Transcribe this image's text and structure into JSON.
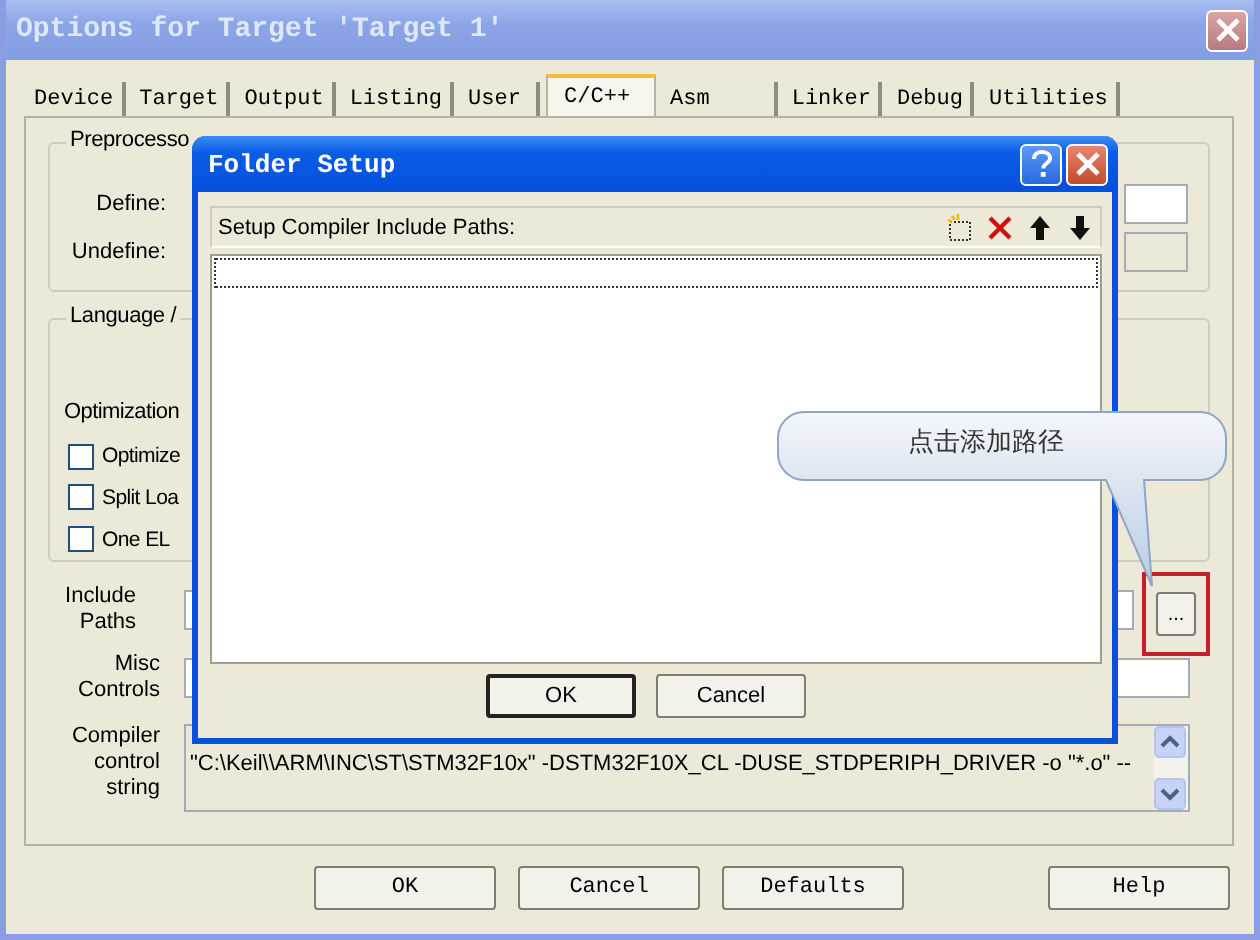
{
  "window": {
    "title": "Options for Target 'Target 1'"
  },
  "tabs": [
    {
      "label": "Device",
      "selected": false
    },
    {
      "label": "Target",
      "selected": false
    },
    {
      "label": "Output",
      "selected": false
    },
    {
      "label": "Listing",
      "selected": false
    },
    {
      "label": "User",
      "selected": false
    },
    {
      "label": "C/C++",
      "selected": true
    },
    {
      "label": "Asm",
      "selected": false
    },
    {
      "label": "Linker",
      "selected": false
    },
    {
      "label": "Debug",
      "selected": false
    },
    {
      "label": "Utilities",
      "selected": false
    }
  ],
  "preprocessor": {
    "title": "Preprocesso",
    "fields": [
      {
        "label": "Define:",
        "disabled": false
      },
      {
        "label": "Undefine:",
        "disabled": true
      }
    ]
  },
  "language": {
    "title": "Language /",
    "optimization_label": "Optimization",
    "options": [
      {
        "label": "Optimize",
        "checked": false
      },
      {
        "label": "Split Loa",
        "checked": false
      },
      {
        "label": "One EL",
        "checked": false
      }
    ]
  },
  "include_paths": {
    "label": "Include Paths",
    "browse_button": "..."
  },
  "misc_controls": {
    "label": "Misc Controls"
  },
  "compiler_control": {
    "label": "Compiler control string",
    "text": "\"C:\\Keil\\\\ARM\\INC\\ST\\STM32F10x\" -DSTM32F10X_CL -DUSE_STDPERIPH_DRIVER -o \"*.o\" --"
  },
  "buttons": [
    "OK",
    "Cancel",
    "Defaults",
    "Help"
  ],
  "folder_setup": {
    "title": "Folder Setup",
    "list_header": "Setup Compiler Include Paths:",
    "buttons": [
      "OK",
      "Cancel"
    ]
  },
  "callout": {
    "text": "点击添加路径"
  }
}
